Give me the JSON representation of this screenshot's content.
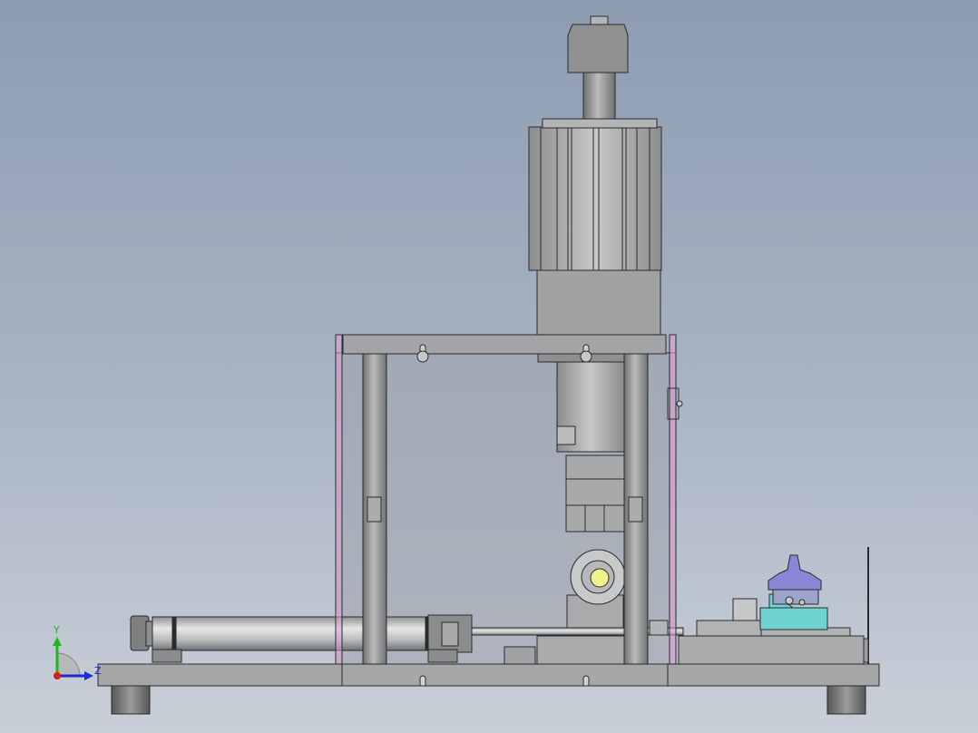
{
  "viewport": {
    "background_top": "#8d9cb1",
    "background_bottom": "#c9cfd8"
  },
  "triad": {
    "y_label": "Y",
    "z_label": "Z",
    "y_color": "#1fb51f",
    "z_color": "#1b2bd8",
    "x_color": "#d81b1b"
  },
  "model": {
    "edge_color": "#2b2b2b",
    "metal_color": "#a9abad",
    "frame_color": "#e39ed8",
    "accent_purple": "#8a86d6",
    "accent_teal": "#6fd3d0",
    "accent_yellow": "#f4f28a"
  }
}
